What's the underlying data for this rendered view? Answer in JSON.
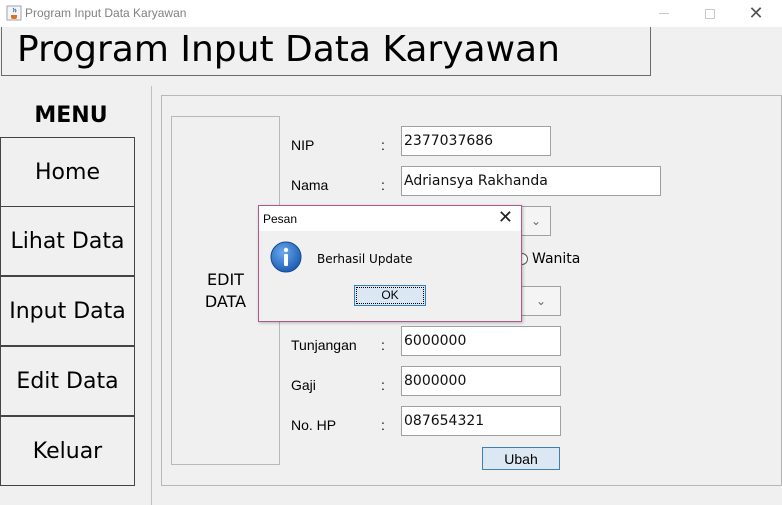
{
  "window": {
    "title": "Program Input Data Karyawan",
    "icon": "java-cup-icon"
  },
  "header": {
    "title": "Program Input Data Karyawan"
  },
  "menu": {
    "title": "MENU",
    "items": [
      {
        "label": "Home"
      },
      {
        "label": "Lihat Data"
      },
      {
        "label": "Input Data"
      },
      {
        "label": "Edit Data"
      },
      {
        "label": "Keluar"
      }
    ]
  },
  "panel": {
    "label_line1": "EDIT",
    "label_line2": "DATA"
  },
  "form": {
    "colon": ":",
    "nip": {
      "label": "NIP",
      "value": "2377037686"
    },
    "nama": {
      "label": "Nama",
      "value": "Adriansya Rakhanda"
    },
    "gender_option": "Wanita",
    "tunjangan": {
      "label": "Tunjangan",
      "value": "6000000"
    },
    "gaji": {
      "label": "Gaji",
      "value": "8000000"
    },
    "nohp": {
      "label": "No. HP",
      "value": "087654321"
    },
    "submit_label": "Ubah"
  },
  "dialog": {
    "title": "Pesan",
    "message": "Berhasil Update",
    "ok_label": "OK",
    "icon": "info-icon"
  },
  "colors": {
    "button_fill": "#dbe8f4",
    "button_border": "#3c7fb1",
    "dialog_border": "#b05a8c",
    "info_icon": "#1f5fb4"
  }
}
